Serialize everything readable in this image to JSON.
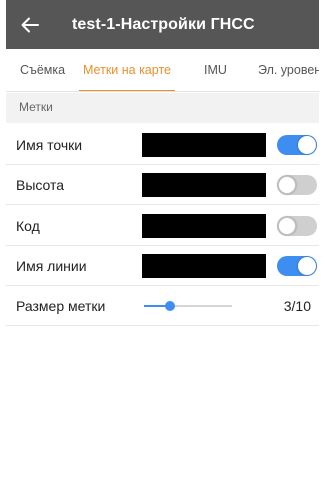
{
  "header": {
    "back_icon": "arrow-left-icon",
    "title": "test-1-Настройки ГНСС",
    "background": "#565656"
  },
  "tabs": [
    {
      "label": "Съёмка",
      "active": false
    },
    {
      "label": "Метки на карте",
      "active": true
    },
    {
      "label": "IMU",
      "active": false
    },
    {
      "label": "Эл. уровень",
      "active": false
    }
  ],
  "accent_color": "#e8912d",
  "section": {
    "title": "Метки"
  },
  "rows": [
    {
      "label": "Имя точки",
      "enabled": true
    },
    {
      "label": "Высота",
      "enabled": false
    },
    {
      "label": "Код",
      "enabled": false
    },
    {
      "label": "Имя линии",
      "enabled": true
    }
  ],
  "marker_size": {
    "label": "Размер метки",
    "value": 3,
    "max": 10,
    "value_text": "3/10"
  },
  "toggle_on_color": "#3d8ef0"
}
